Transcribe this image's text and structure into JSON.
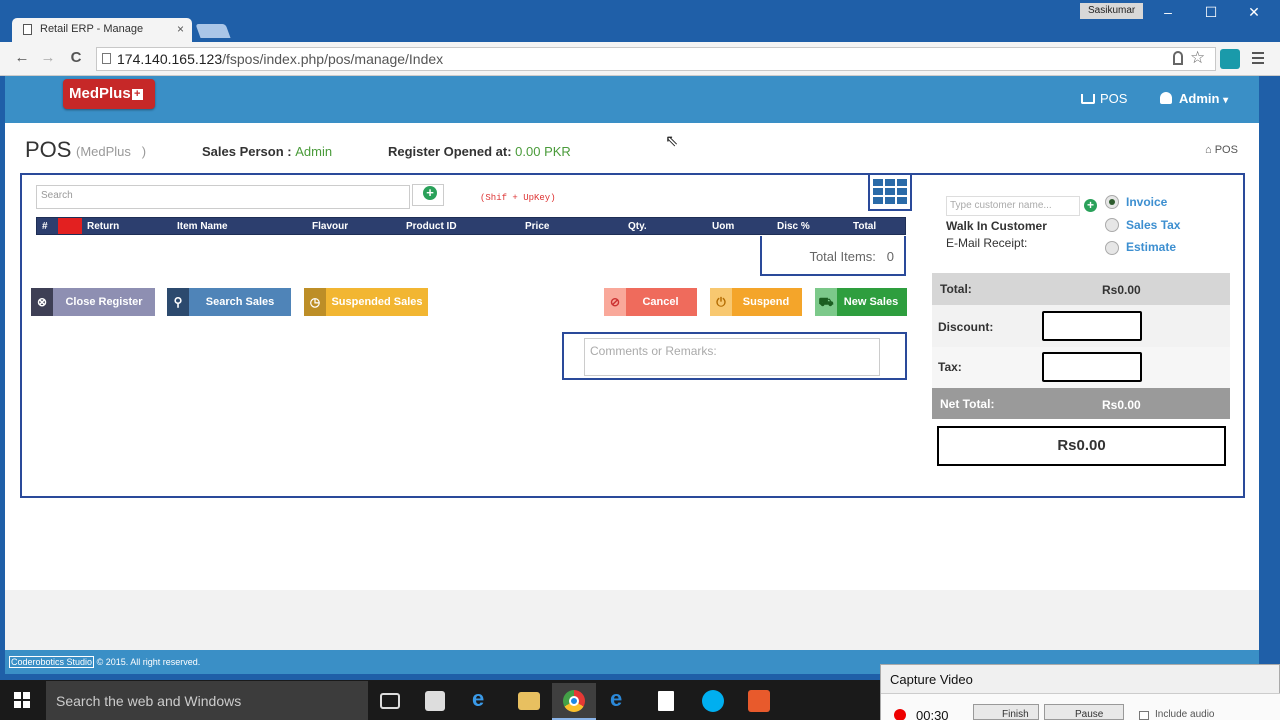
{
  "browser": {
    "tab_title": "Retail ERP - Manage",
    "tab_close": "×",
    "user_badge": "Sasikumar",
    "url_host": "174.140.165.123",
    "url_path": "/fspos/index.php/pos/manage/Index",
    "window_controls": {
      "minimize": "–",
      "maximize": "☐",
      "close": "✕"
    },
    "nav": {
      "back": "←",
      "forward": "→",
      "reload": "C"
    }
  },
  "app": {
    "logo_text": "MedPlus",
    "logo_plus": "+",
    "nav_pos": "POS",
    "nav_admin": "Admin",
    "caret": "▾"
  },
  "header": {
    "title": "POS",
    "subtitle": "(MedPlus   )",
    "sales_person_label": "Sales Person :",
    "sales_person_value": "Admin",
    "register_label": "Register Opened at:",
    "register_value": "0.00 PKR",
    "breadcrumb": "POS"
  },
  "search": {
    "placeholder": "Search",
    "shortcut": "(Shif + UpKey)",
    "add": "+"
  },
  "table": {
    "columns": [
      "#",
      "Return",
      "Item Name",
      "Flavour",
      "Product ID",
      "Price",
      "Qty.",
      "Uom",
      "Disc %",
      "Total"
    ],
    "total_items_label": "Total Items:",
    "total_items_value": "0"
  },
  "actions": {
    "close_register": "Close Register",
    "search_sales": "Search Sales",
    "suspended_sales": "Suspended Sales",
    "cancel": "Cancel",
    "suspend": "Suspend",
    "new_sales": "New Sales"
  },
  "comments": {
    "placeholder": "Comments or Remarks:"
  },
  "customer": {
    "placeholder": "Type customer name...",
    "default_name": "Walk In Customer",
    "email_label": "E-Mail Receipt:",
    "add": "+",
    "options": [
      "Invoice",
      "Sales Tax",
      "Estimate"
    ],
    "selected": "Invoice"
  },
  "summary": {
    "total_label": "Total:",
    "total_value": "Rs0.00",
    "discount_label": "Discount:",
    "tax_label": "Tax:",
    "net_total_label": "Net Total:",
    "net_total_value": "Rs0.00",
    "grand_total": "Rs0.00"
  },
  "footer": {
    "brand": "Coderobotics Studio",
    "text": " © 2015. All right reserved."
  },
  "taskbar": {
    "search_placeholder": "Search the web and Windows"
  },
  "capture": {
    "title": "Capture Video",
    "time": "00:30",
    "finish": "Finish",
    "pause": "Pause",
    "include_audio": "Include audio"
  },
  "colors": {
    "accent": "#3a8fc6",
    "table_header": "#2c3e6e",
    "close_register": "#8e8fb2",
    "search_sales": "#4f84b8",
    "suspended_sales": "#f2b632",
    "cancel": "#ef6b5c",
    "suspend": "#f4a52a",
    "new_sales": "#2e9e3e"
  }
}
